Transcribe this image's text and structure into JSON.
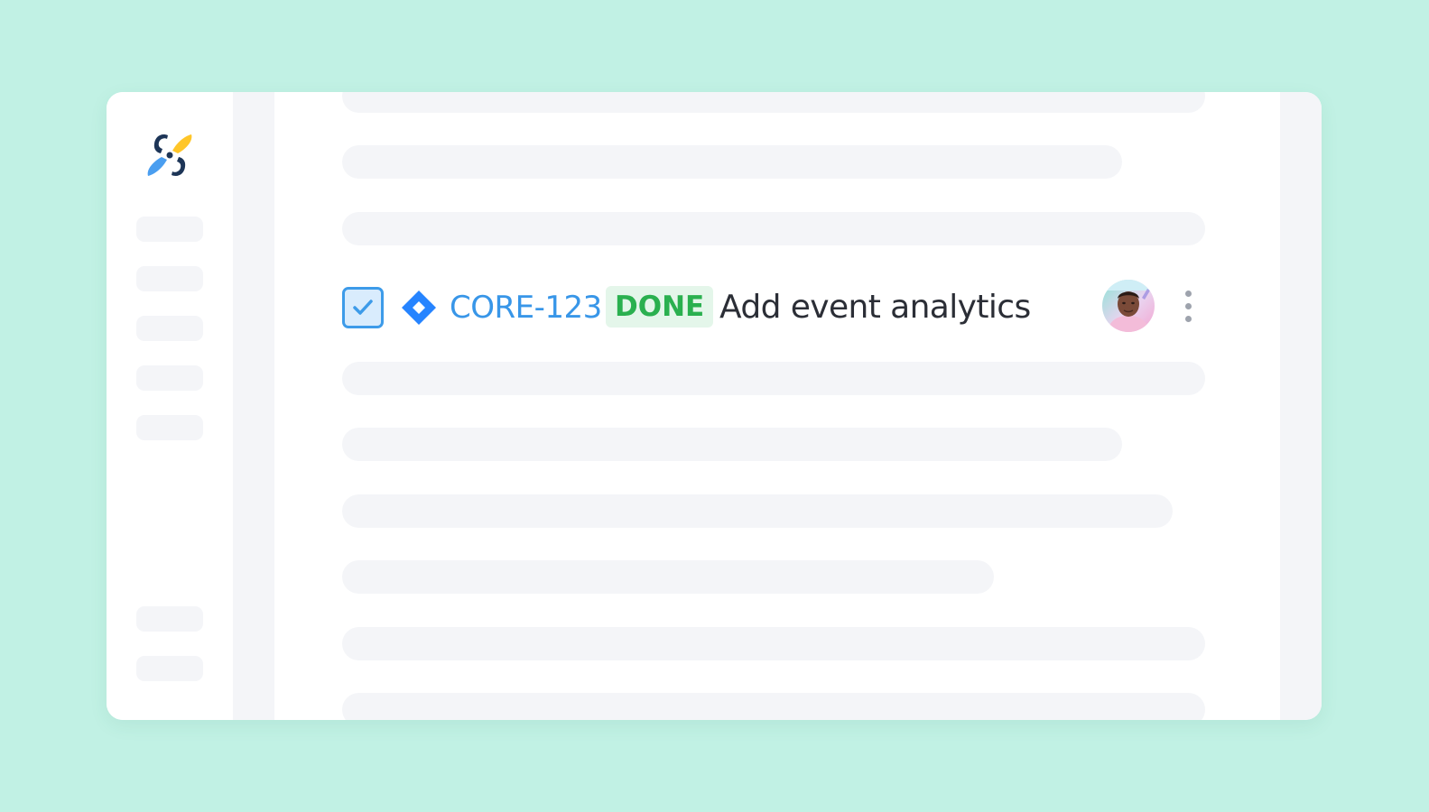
{
  "issue": {
    "key": "CORE-123",
    "status": "DONE",
    "title": "Add event analytics",
    "checked": true
  },
  "colors": {
    "background": "#c1f1e4",
    "accent_blue": "#3896e8",
    "status_green": "#2ab04f",
    "placeholder_gray": "#f4f5f8",
    "jira_blue": "#2684ff"
  },
  "icons": {
    "logo": "propeller-logo-icon",
    "checkbox": "checkbox-checked-icon",
    "issue_type": "jira-diamond-icon",
    "menu": "more-vertical-icon"
  }
}
